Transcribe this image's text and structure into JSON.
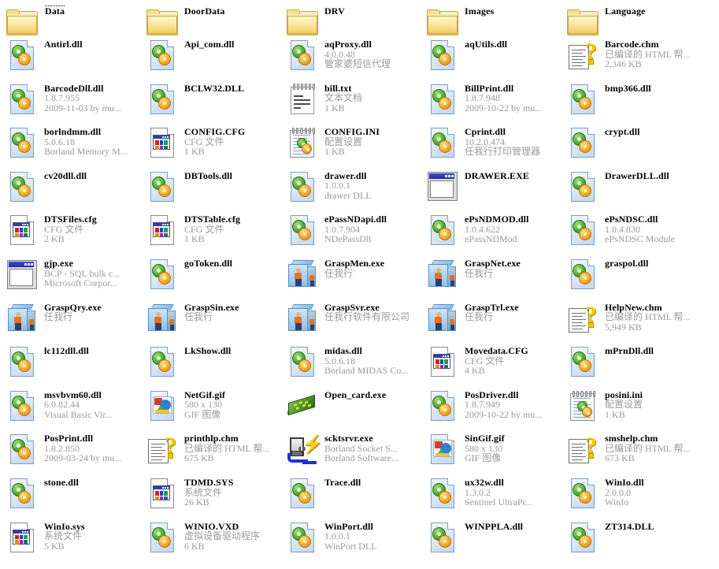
{
  "view": {
    "name": "windows-explorer-tiles",
    "background": "#ffffff",
    "columns": 5,
    "rows": 9
  },
  "items": [
    {
      "icon": "folder",
      "name": "Data",
      "line2": "",
      "line3": "",
      "focused": true
    },
    {
      "icon": "folder",
      "name": "DoorData",
      "line2": "",
      "line3": ""
    },
    {
      "icon": "folder",
      "name": "DRV",
      "line2": "",
      "line3": ""
    },
    {
      "icon": "folder",
      "name": "Images",
      "line2": "",
      "line3": ""
    },
    {
      "icon": "folder",
      "name": "Language",
      "line2": "",
      "line3": ""
    },
    {
      "icon": "dll",
      "name": "Antirl.dll",
      "line2": "",
      "line3": ""
    },
    {
      "icon": "dll",
      "name": "Api_com.dll",
      "line2": "",
      "line3": ""
    },
    {
      "icon": "dll",
      "name": "aqProxy.dll",
      "line2": "4.0.0.48",
      "line3": "管家婆短信代理"
    },
    {
      "icon": "dll",
      "name": "aqUtils.dll",
      "line2": "",
      "line3": ""
    },
    {
      "icon": "chm",
      "name": "Barcode.chm",
      "line2": "已编译的 HTML 帮...",
      "line3": "2,346 KB"
    },
    {
      "icon": "dll",
      "name": "BarcodeDll.dll",
      "line2": "1.8.7.955",
      "line3": "2009-11-03 by mu..."
    },
    {
      "icon": "dll",
      "name": "BCLW32.DLL",
      "line2": "",
      "line3": ""
    },
    {
      "icon": "txt",
      "name": "bill.txt",
      "line2": "文本文档",
      "line3": "1 KB"
    },
    {
      "icon": "dll",
      "name": "BillPrint.dll",
      "line2": "1.8.7.948",
      "line3": "2009-10-22 by mu..."
    },
    {
      "icon": "dll",
      "name": "bmp366.dll",
      "line2": "",
      "line3": ""
    },
    {
      "icon": "dll",
      "name": "borlndmm.dll",
      "line2": "5.0.6.18",
      "line3": "Borland Memory M..."
    },
    {
      "icon": "cfg",
      "name": "CONFIG.CFG",
      "line2": "CFG 文件",
      "line3": "1 KB"
    },
    {
      "icon": "ini",
      "name": "CONFIG.INI",
      "line2": "配置设置",
      "line3": "1 KB"
    },
    {
      "icon": "dll",
      "name": "Cprint.dll",
      "line2": "10.2.0.474",
      "line3": "任我行打印管理器"
    },
    {
      "icon": "dll",
      "name": "crypt.dll",
      "line2": "",
      "line3": ""
    },
    {
      "icon": "dll",
      "name": "cv20dll.dll",
      "line2": "",
      "line3": ""
    },
    {
      "icon": "dll",
      "name": "DBTools.dll",
      "line2": "",
      "line3": ""
    },
    {
      "icon": "dll",
      "name": "drawer.dll",
      "line2": "1.0.0.1",
      "line3": "drawer DLL"
    },
    {
      "icon": "exe",
      "name": "DRAWER.EXE",
      "line2": "",
      "line3": ""
    },
    {
      "icon": "dll",
      "name": "DrawerDLL.dll",
      "line2": "",
      "line3": ""
    },
    {
      "icon": "cfg",
      "name": "DTSFiles.cfg",
      "line2": "CFG 文件",
      "line3": "2 KB"
    },
    {
      "icon": "cfg",
      "name": "DTSTable.cfg",
      "line2": "CFG 文件",
      "line3": "1 KB"
    },
    {
      "icon": "dll",
      "name": "ePassNDapi.dll",
      "line2": "1.0.7.904",
      "line3": "NDePassDll"
    },
    {
      "icon": "dll",
      "name": "ePsNDMOD.dll",
      "line2": "1.0.4.622",
      "line3": "ePassNDMod"
    },
    {
      "icon": "dll",
      "name": "ePsNDSC.dll",
      "line2": "1.0.4.830",
      "line3": "ePsNDSC Module"
    },
    {
      "icon": "exe",
      "name": "gjp.exe",
      "line2": "BCP - SQL bulk c...",
      "line3": "Microsoft Corpor..."
    },
    {
      "icon": "dll",
      "name": "goToken.dll",
      "line2": "",
      "line3": ""
    },
    {
      "icon": "cube",
      "name": "GraspMen.exe",
      "line2": "任我行",
      "line3": ""
    },
    {
      "icon": "cube",
      "name": "GraspNet.exe",
      "line2": "任我行",
      "line3": ""
    },
    {
      "icon": "dll",
      "name": "graspol.dll",
      "line2": "",
      "line3": ""
    },
    {
      "icon": "cube",
      "name": "GraspQry.exe",
      "line2": "任我行",
      "line3": ""
    },
    {
      "icon": "cube",
      "name": "GraspSin.exe",
      "line2": "任我行",
      "line3": ""
    },
    {
      "icon": "cube",
      "name": "GraspSvr.exe",
      "line2": "任我行软件有限公司",
      "line3": ""
    },
    {
      "icon": "cube",
      "name": "GraspTrl.exe",
      "line2": "任我行",
      "line3": ""
    },
    {
      "icon": "chm",
      "name": "HelpNew.chm",
      "line2": "已编译的 HTML 帮...",
      "line3": "5,949 KB"
    },
    {
      "icon": "dll",
      "name": "lc112dll.dll",
      "line2": "",
      "line3": ""
    },
    {
      "icon": "dll",
      "name": "LkShow.dll",
      "line2": "",
      "line3": ""
    },
    {
      "icon": "dll",
      "name": "midas.dll",
      "line2": "5.0.6.18",
      "line3": "Borland MIDAS Co..."
    },
    {
      "icon": "cfg",
      "name": "Movedata.CFG",
      "line2": "CFG 文件",
      "line3": "4 KB"
    },
    {
      "icon": "dll",
      "name": "mPrnDll.dll",
      "line2": "",
      "line3": ""
    },
    {
      "icon": "dll",
      "name": "msvbvm60.dll",
      "line2": "6.0.82.44",
      "line3": "Visual Basic Vir..."
    },
    {
      "icon": "gif",
      "name": "NetGif.gif",
      "line2": "580 x 130",
      "line3": "GIF 图像"
    },
    {
      "icon": "card",
      "name": "Open_card.exe",
      "line2": "",
      "line3": ""
    },
    {
      "icon": "dll",
      "name": "PosDriver.dll",
      "line2": "1.8.7.949",
      "line3": "2009-10-22 by mu..."
    },
    {
      "icon": "ini",
      "name": "posini.ini",
      "line2": "配置设置",
      "line3": "1 KB"
    },
    {
      "icon": "dll",
      "name": "PosPrint.dll",
      "line2": "1.8.2.850",
      "line3": "2009-03-24 by mu..."
    },
    {
      "icon": "chm",
      "name": "printhlp.chm",
      "line2": "已编译的 HTML 帮...",
      "line3": "675 KB"
    },
    {
      "icon": "sckt",
      "name": "scktsrvr.exe",
      "line2": "Borland Socket S...",
      "line3": "Borland Software..."
    },
    {
      "icon": "gif",
      "name": "SinGif.gif",
      "line2": "580 x 130",
      "line3": "GIF 图像"
    },
    {
      "icon": "chm",
      "name": "smshelp.chm",
      "line2": "已编译的 HTML 帮...",
      "line3": "673 KB"
    },
    {
      "icon": "dll",
      "name": "stone.dll",
      "line2": "",
      "line3": ""
    },
    {
      "icon": "cfg",
      "name": "TDMD.SYS",
      "line2": "系统文件",
      "line3": "26 KB"
    },
    {
      "icon": "dll",
      "name": "Trace.dll",
      "line2": "",
      "line3": ""
    },
    {
      "icon": "dll",
      "name": "ux32w.dll",
      "line2": "1.3.0.2",
      "line3": "Sentinel UltraPr..."
    },
    {
      "icon": "dll",
      "name": "WinIo.dll",
      "line2": "2.0.0.0",
      "line3": "WinIo"
    },
    {
      "icon": "cfg",
      "name": "WinIo.sys",
      "line2": "系统文件",
      "line3": "5 KB"
    },
    {
      "icon": "dll",
      "name": "WINIO.VXD",
      "line2": "虚拟设备驱动程序",
      "line3": "6 KB"
    },
    {
      "icon": "dll",
      "name": "WinPort.dll",
      "line2": "1.0.0.1",
      "line3": "WinPort DLL"
    },
    {
      "icon": "dll",
      "name": "WINPPLA.dll",
      "line2": "",
      "line3": ""
    },
    {
      "icon": "dll",
      "name": "ZT314.DLL",
      "line2": "",
      "line3": ""
    }
  ]
}
